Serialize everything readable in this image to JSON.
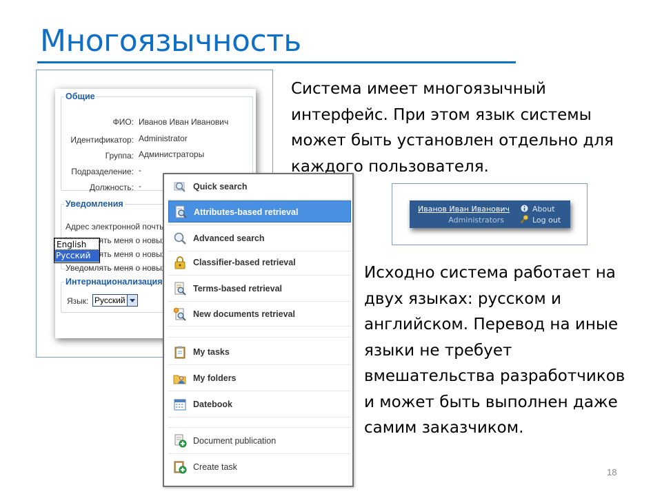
{
  "slide": {
    "title": "Многоязычность",
    "paragraph1": "Система имеет многоязычный интерфейс. При этом язык системы может быть установлен отдельно для каждого пользователя.",
    "paragraph2": "Исходно система работает на двух языках: русском и английском. Перевод на иные языки не требует вмешательства разработчиков и может быть выполнен даже самим заказчиком.",
    "page_number": "18",
    "accent_color": "#0f6fc6"
  },
  "settings": {
    "common_legend": "Общие",
    "fields": [
      {
        "label": "ФИО:",
        "value": "Иванов Иван Иванович"
      },
      {
        "label": "Идентификатор:",
        "value": "Administrator"
      },
      {
        "label": "Группа:",
        "value": "Администраторы"
      },
      {
        "label": "Подразделение:",
        "value": "-"
      },
      {
        "label": "Должность:",
        "value": "-"
      }
    ],
    "notify_legend": "Уведомления",
    "notify_lines": [
      "Адрес электронной почты",
      "Уведомлять меня о новых",
      "Уведомлять меня о новых",
      "Уведомлять меня о новых"
    ],
    "intl_legend": "Интернационализация",
    "language_label": "Язык:",
    "language_value": "Русский",
    "language_options": [
      "English",
      "Русский"
    ]
  },
  "menu": {
    "items": [
      {
        "label": "Quick search",
        "icon": "magnifier-icon"
      },
      {
        "label": "Attributes-based retrieval",
        "icon": "document-search-icon"
      },
      {
        "label": "Advanced search",
        "icon": "magnifier-icon"
      },
      {
        "label": "Classifier-based retrieval",
        "icon": "lock-icon"
      },
      {
        "label": "Terms-based retrieval",
        "icon": "document-search-icon"
      },
      {
        "label": "New documents retrieval",
        "icon": "new-document-search-icon"
      },
      {
        "label": "My tasks",
        "icon": "clipboard-icon"
      },
      {
        "label": "My folders",
        "icon": "user-folder-icon"
      },
      {
        "label": "Datebook",
        "icon": "calendar-icon"
      },
      {
        "label": "Document publication",
        "icon": "document-add-icon"
      },
      {
        "label": "Create task",
        "icon": "clipboard-add-icon"
      }
    ]
  },
  "user_header": {
    "name": "Иванов Иван Иванович",
    "role": "Administrators",
    "about_label": "About",
    "logout_label": "Log out"
  }
}
